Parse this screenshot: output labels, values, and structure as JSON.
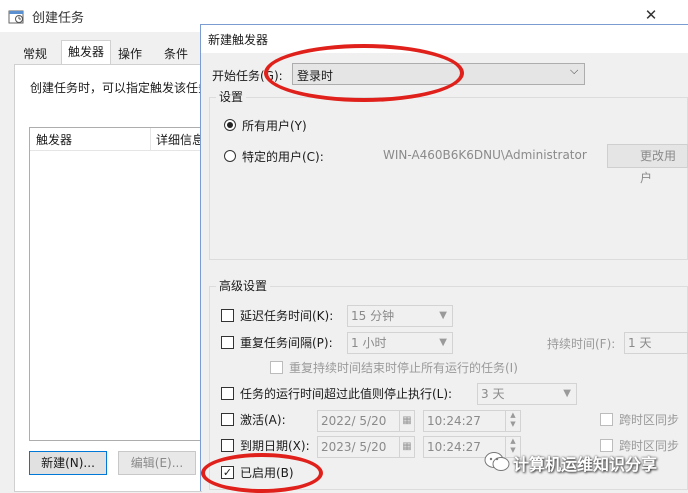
{
  "back_window": {
    "title": "创建任务",
    "tabs": [
      "常规",
      "触发器",
      "操作",
      "条件"
    ],
    "active_tab": "触发器",
    "description": "创建任务时，可以指定触发该任务",
    "list_columns": [
      "触发器",
      "详细信息"
    ],
    "new_button": "新建(N)...",
    "edit_button": "编辑(E)..."
  },
  "dialog": {
    "title": "新建触发器",
    "begin_task_label": "开始任务(G):",
    "begin_task_value": "登录时",
    "settings": {
      "group_label": "设置",
      "radio_all_users": "所有用户(Y)",
      "radio_specific_user": "特定的用户(C):",
      "selected": "radio_all_users",
      "user_value": "WIN-A460B6K6DNU\\Administrator",
      "change_user_button": "更改用户"
    },
    "advanced": {
      "group_label": "高级设置",
      "delay_label": "延迟任务时间(K):",
      "delay_value": "15 分钟",
      "repeat_label": "重复任务间隔(P):",
      "repeat_value": "1 小时",
      "duration_label": "持续时间(F):",
      "duration_value": "1 天",
      "stop_at_end_label": "重复持续时间结束时停止所有运行的任务(I)",
      "stop_if_runs_label": "任务的运行时间超过此值则停止执行(L):",
      "stop_if_runs_value": "3 天",
      "activate_label": "激活(A):",
      "activate_date": "2022/ 5/20",
      "activate_time": "10:24:27",
      "expire_label": "到期日期(X):",
      "expire_date": "2023/ 5/20",
      "expire_time": "10:24:27",
      "sync_tz_label": "跨时区同步",
      "enabled_label": "已启用(B)",
      "enabled_checked": true
    }
  },
  "watermark": {
    "text": "计算机运维知识分享"
  },
  "colors": {
    "highlight_ellipse": "#e0201a",
    "primary_button_border": "#0078d7"
  }
}
